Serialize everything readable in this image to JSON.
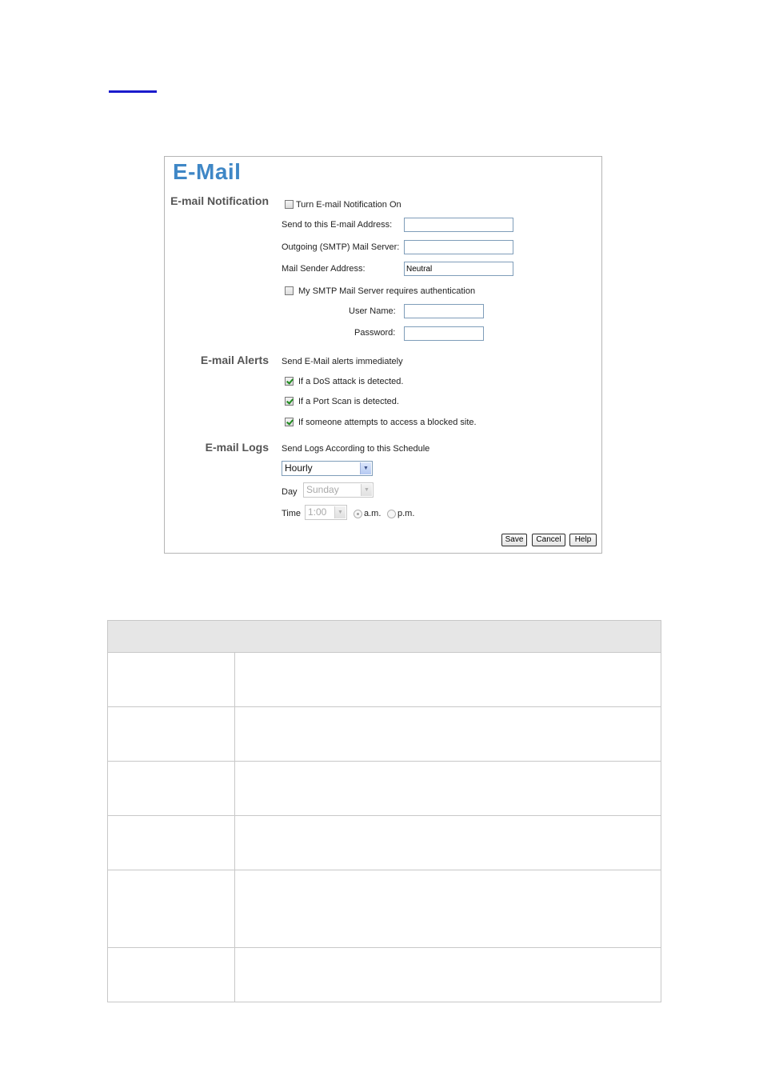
{
  "panel": {
    "title": "E-Mail",
    "notification": {
      "section_label": "E-mail Notification",
      "turn_on_label": "Turn E-mail Notification On",
      "turn_on_checked": false,
      "send_to_label": "Send to this E-mail Address:",
      "send_to_value": "",
      "smtp_label": "Outgoing (SMTP) Mail Server:",
      "smtp_value": "",
      "sender_label": "Mail Sender Address:",
      "sender_value": "Neutral",
      "auth_label": "My SMTP Mail Server requires authentication",
      "auth_checked": false,
      "username_label": "User Name:",
      "username_value": "",
      "password_label": "Password:",
      "password_value": ""
    },
    "alerts": {
      "section_label": "E-mail Alerts",
      "intro": "Send E-Mail alerts immediately",
      "items": [
        {
          "label": "If a DoS attack is detected.",
          "checked": true
        },
        {
          "label": "If a Port Scan is detected.",
          "checked": true
        },
        {
          "label": "If someone attempts to access a blocked site.",
          "checked": true
        }
      ]
    },
    "logs": {
      "section_label": "E-mail Logs",
      "intro": "Send Logs According to this Schedule",
      "schedule_value": "Hourly",
      "day_label": "Day",
      "day_value": "Sunday",
      "time_label": "Time",
      "time_value": "1:00",
      "am_label": "a.m.",
      "pm_label": "p.m.",
      "meridiem_selected": "a.m."
    },
    "buttons": {
      "save": "Save",
      "cancel": "Cancel",
      "help": "Help"
    }
  },
  "description_table": {
    "header": "",
    "rows": [
      {
        "name": "",
        "description": ""
      },
      {
        "name": "",
        "description": ""
      },
      {
        "name": "",
        "description": ""
      },
      {
        "name": "",
        "description": ""
      },
      {
        "name": "",
        "description": ""
      },
      {
        "name": "",
        "description": ""
      }
    ]
  },
  "colors": {
    "title_blue": "#3f87c6",
    "link_blue": "#1a1acc",
    "checkmark_green": "#1e8a1e"
  }
}
